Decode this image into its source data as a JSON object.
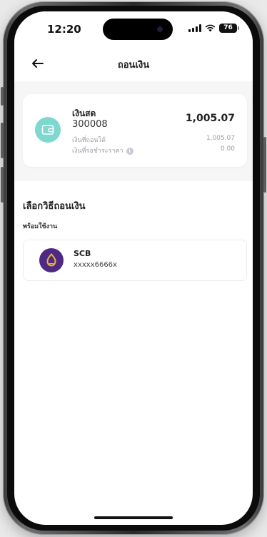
{
  "status_bar": {
    "time": "12:20",
    "battery_level": "76"
  },
  "nav": {
    "title": "ถอนเงิน",
    "back_icon": "arrow-left-icon"
  },
  "balance_card": {
    "icon": "wallet-icon",
    "icon_color": "#7fd8cf",
    "account_name": "เงินสด",
    "account_number": "300008",
    "total_amount": "1,005.07",
    "withdrawable_label": "เงินที่ถอนได้",
    "withdrawable_value": "1,005.07",
    "pending_label": "เงินที่รอชำระราคา",
    "pending_value": "0.00"
  },
  "withdraw_section": {
    "title": "เลือกวิธีถอนเงิน",
    "group_label": "พร้อมใช้งาน",
    "methods": [
      {
        "bank_name": "SCB",
        "account": "xxxxx6666x",
        "logo_color": "#4e2a84",
        "logo_accent": "#e8b43a"
      }
    ]
  }
}
